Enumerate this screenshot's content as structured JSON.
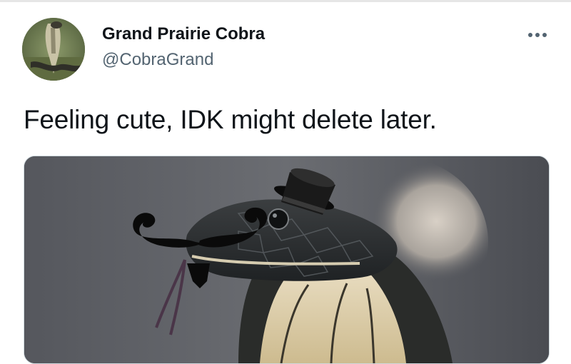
{
  "tweet": {
    "author": {
      "display_name": "Grand Prairie Cobra",
      "handle": "@CobraGrand",
      "avatar_icon": "cobra-avatar"
    },
    "more_icon": "more-horizontal-icon",
    "text": "Feeling cute, IDK might delete later.",
    "media": {
      "subject": "cobra-with-top-hat-and-mustache"
    }
  },
  "colors": {
    "text_primary": "#0f1419",
    "text_secondary": "#536471",
    "border": "#cfd9de"
  }
}
